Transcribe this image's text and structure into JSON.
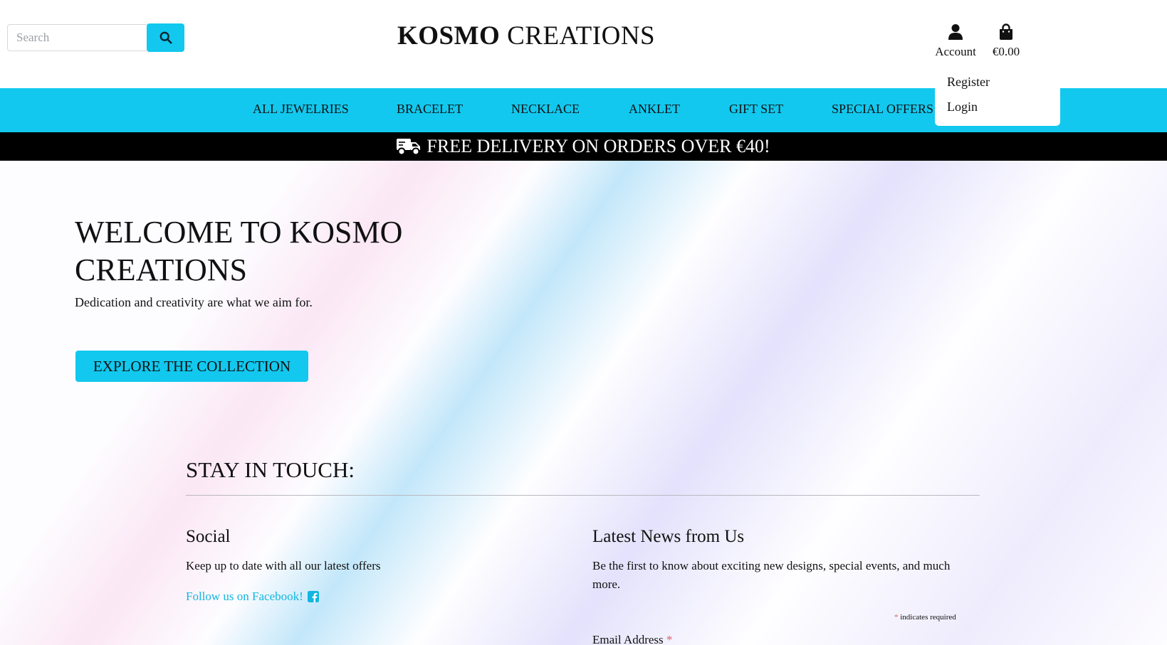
{
  "header": {
    "search": {
      "placeholder": "Search",
      "value": "",
      "button_icon": "search-icon"
    },
    "brand": {
      "bold": "KOSMO",
      "rest": "CREATIONS"
    },
    "account": {
      "label": "Account",
      "icon": "user-icon"
    },
    "cart": {
      "amount": "€0.00",
      "icon": "shopping-bag-icon"
    },
    "account_menu": [
      "Register",
      "Login"
    ]
  },
  "nav": {
    "items": [
      "ALL JEWELRIES",
      "BRACELET",
      "NECKLACE",
      "ANKLET",
      "GIFT SET",
      "SPECIAL OFFERS"
    ]
  },
  "banner": {
    "text": "FREE DELIVERY ON ORDERS OVER €40!",
    "icon": "truck-icon"
  },
  "hero": {
    "title": "WELCOME TO KOSMO CREATIONS",
    "subtitle": "Dedication and creativity are what we aim for.",
    "button": "EXPLORE THE COLLECTION"
  },
  "stay_in_touch": {
    "title": "STAY IN TOUCH:",
    "social": {
      "title": "Social",
      "text": "Keep up to date with all our latest offers",
      "link": "Follow us on Facebook!",
      "link_icon": "facebook-icon"
    },
    "news": {
      "title": "Latest News from Us",
      "text": "Be the first to know about exciting new designs, special events, and much more.",
      "required_marker": "*",
      "required_note": "indicates required",
      "email_label": "Email Address"
    }
  },
  "colors": {
    "accent": "#12c8ee",
    "banner_bg": "#000000",
    "link": "#12b6e0",
    "required": "#e06060"
  }
}
